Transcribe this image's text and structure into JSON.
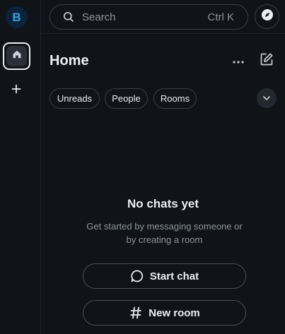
{
  "user": {
    "avatar_letter": "B",
    "avatar_color": "#2aa7e7"
  },
  "rail": {
    "home_icon": "home-icon",
    "add_icon": "plus-icon"
  },
  "search": {
    "placeholder": "Search",
    "shortcut": "Ctrl K"
  },
  "header": {
    "title": "Home"
  },
  "filters": [
    {
      "label": "Unreads"
    },
    {
      "label": "People"
    },
    {
      "label": "Rooms"
    }
  ],
  "empty_state": {
    "title": "No chats yet",
    "description_line1": "Get started by messaging someone or",
    "description_line2": "by creating a room",
    "start_chat_label": "Start chat",
    "new_room_label": "New room"
  },
  "colors": {
    "background": "#101317",
    "border": "#3b4048",
    "text": "#ebeef2",
    "muted": "#8f959d"
  }
}
